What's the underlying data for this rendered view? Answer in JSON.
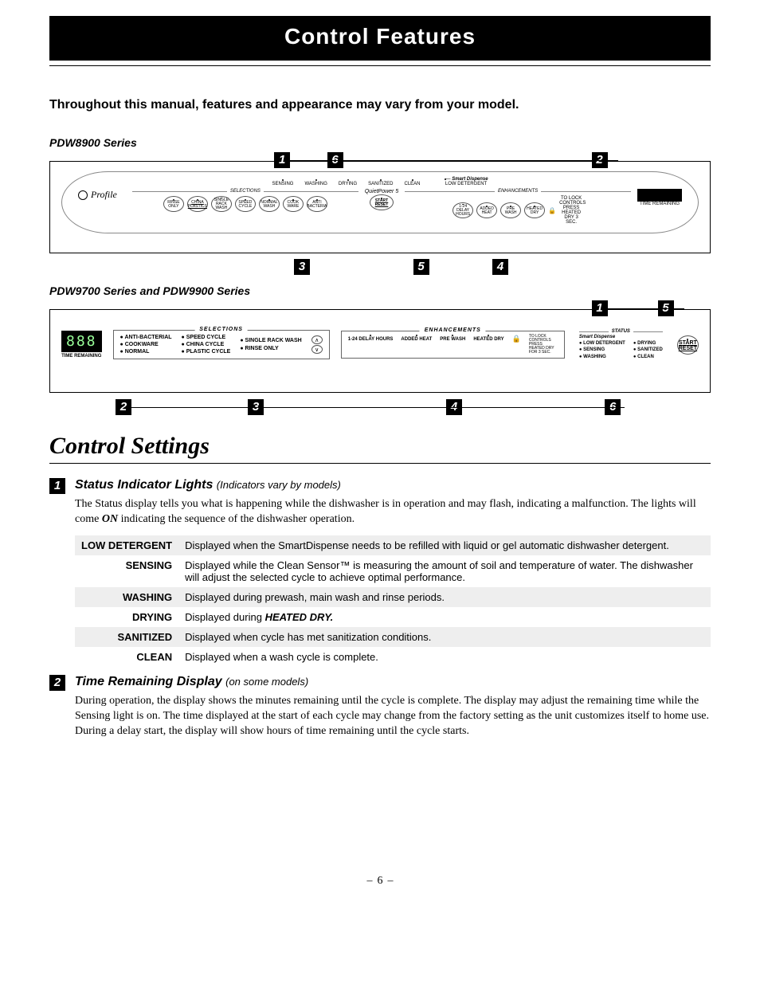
{
  "page_title": "Control  Features",
  "intro": "Throughout this manual, features and appearance may vary from your model.",
  "series1": {
    "label": "PDW8900 Series",
    "brand": "Profile",
    "top_leds": [
      "SENSING",
      "WASHING",
      "DRYING",
      "SANITIZED",
      "CLEAN"
    ],
    "smart_dispense": "Smart Dispense",
    "low_detergent": "LOW DETERGENT",
    "quiet": "QuietPower 5",
    "selections_label": "SELECTIONS",
    "enhancements_label": "ENHANCEMENTS",
    "selection_btns": [
      "RINSE ONLY",
      "CHINA PLASTICS",
      "SINGLE RACK WASH",
      "SPEED CYCLE",
      "NORMAL WASH",
      "COOK WARE",
      "ANTI BACTERIA"
    ],
    "enh_btns": [
      "1-24 DELAY HOURS",
      "ADDED HEAT",
      "PRE WASH",
      "HEATED DRY"
    ],
    "start_btn": "START RESET",
    "time_remaining": "TIME REMAINING",
    "lock_note": "TO LOCK CONTROLS PRESS HEATED DRY 3 SEC.",
    "callouts_top": [
      {
        "num": "1",
        "pos": 34
      },
      {
        "num": "6",
        "pos": 42
      },
      {
        "num": "2",
        "pos": 82
      }
    ],
    "callouts_bottom": [
      {
        "num": "3",
        "pos": 37
      },
      {
        "num": "5",
        "pos": 55
      },
      {
        "num": "4",
        "pos": 67
      }
    ]
  },
  "series2": {
    "label": "PDW9700 Series and PDW9900 Series",
    "seg": "888",
    "seg_label": "TIME REMAINING",
    "selections_label": "SELECTIONS",
    "selections": [
      [
        "ANTI-BACTERIAL",
        "COOKWARE",
        "NORMAL"
      ],
      [
        "SPEED CYCLE",
        "CHINA CYCLE",
        "PLASTIC CYCLE"
      ],
      [
        "SINGLE RACK WASH",
        "RINSE ONLY"
      ]
    ],
    "enhancements_label": "ENHANCEMENTS",
    "enh": [
      "1-24 DELAY HOURS",
      "ADDED HEAT",
      "PRE WASH",
      "HEATED DRY"
    ],
    "lock_note": "TO LOCK CONTROLS PRESS HEATED DRY FOR 3 SEC.",
    "status_label": "STATUS",
    "smart_dispense": "Smart Dispense",
    "status_cols": [
      [
        "LOW DETERGENT",
        "SENSING",
        "WASHING"
      ],
      [
        "DRYING",
        "SANITIZED",
        "CLEAN"
      ]
    ],
    "start_btn_top": "START",
    "start_btn_bottom": "RESET",
    "callouts_top": [
      {
        "num": "1",
        "pos": 82
      },
      {
        "num": "5",
        "pos": 92
      }
    ],
    "callouts_bottom": [
      {
        "num": "2",
        "pos": 10
      },
      {
        "num": "3",
        "pos": 30
      },
      {
        "num": "4",
        "pos": 60
      },
      {
        "num": "6",
        "pos": 84
      }
    ]
  },
  "control_settings_heading": "Control Settings",
  "section1": {
    "num": "1",
    "title": "Status Indicator Lights",
    "paren": "(Indicators vary by models)",
    "body_pre": "The Status display tells you what is happening while the dishwasher is in operation and may flash, indicating a malfunction. The lights will come ",
    "body_on": "ON",
    "body_post": " indicating the sequence of the dishwasher operation.",
    "rows": [
      {
        "label": "LOW DETERGENT",
        "desc": "Displayed when the SmartDispense needs to be refilled with liquid or gel automatic dishwasher detergent."
      },
      {
        "label": "SENSING",
        "desc": "Displayed while the Clean Sensor™ is measuring the amount of soil and temperature of water. The dishwasher will adjust the selected cycle to achieve optimal performance."
      },
      {
        "label": "WASHING",
        "desc": "Displayed during prewash, main wash and rinse periods."
      },
      {
        "label": "DRYING",
        "desc_pre": "Displayed during ",
        "desc_bold": "HEATED DRY.",
        "desc_post": ""
      },
      {
        "label": "SANITIZED",
        "desc": "Displayed when cycle has met sanitization conditions."
      },
      {
        "label": "CLEAN",
        "desc": "Displayed when a wash cycle is complete."
      }
    ]
  },
  "section2": {
    "num": "2",
    "title": "Time Remaining Display",
    "paren": "(on some models)",
    "body": "During operation, the display shows the minutes remaining until the cycle is complete. The display may adjust the remaining time while the Sensing light is on. The time displayed at the start of each cycle may change from the factory setting as the unit customizes itself to home use. During a delay start, the display will show hours of time remaining until the cycle starts."
  },
  "page_number": "6"
}
